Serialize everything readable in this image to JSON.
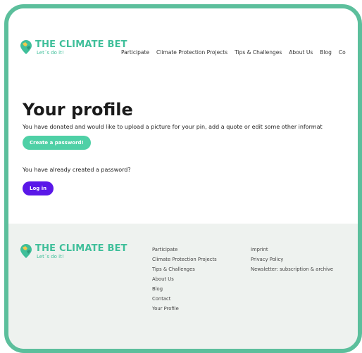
{
  "brand": {
    "title": "THE CLIMATE BET",
    "tagline": "Let´s do it!",
    "color": "#3fbf9a"
  },
  "nav": {
    "items": [
      "Participate",
      "Climate Protection Projects",
      "Tips & Challenges",
      "About Us",
      "Blog",
      "Co"
    ]
  },
  "main": {
    "title": "Your profile",
    "intro": "You have donated and would like to upload a picture for your pin, add a quote or edit some other informat",
    "create_button": "Create a password!",
    "already_text": "You have already created a password?",
    "login_button": "Log in"
  },
  "footer": {
    "col1": [
      "Participate",
      "Climate Protection Projects",
      "Tips & Challenges",
      "About Us",
      "Blog",
      "Contact",
      "Your Profile"
    ],
    "col2": [
      "Imprint",
      "Privacy Policy",
      "Newsletter: subscription & archive"
    ]
  },
  "colors": {
    "frame": "#5cbf9c",
    "accent": "#4fd0a6",
    "login": "#5a17e8",
    "footer_bg": "#eef2ef"
  }
}
